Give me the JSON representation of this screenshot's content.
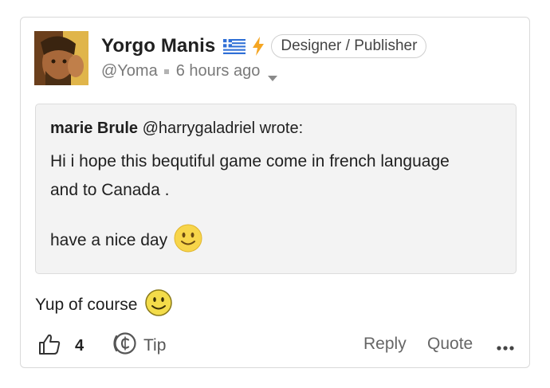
{
  "post": {
    "author": {
      "name": "Yorgo Manis",
      "handle": "@Yoma",
      "role_badge": "Designer / Publisher",
      "flag_icon": "greece-flag-icon",
      "badge_icon": "lightning-bolt-icon"
    },
    "time_ago": "6 hours ago",
    "quote": {
      "author_name": "marie Brule",
      "author_handle": "@harrygaladriel",
      "wrote": "wrote:",
      "line1": "Hi i hope this bequtiful game come in french language",
      "line2": "and to Canada .",
      "line3": "have a nice day"
    },
    "reply_text": "Yup of course",
    "actions": {
      "like_count": "4",
      "tip_label": "Tip",
      "reply_label": "Reply",
      "quote_label": "Quote"
    },
    "colors": {
      "accent_bolt": "#f5a623",
      "flag_blue": "#2f6fd6",
      "emoji_yellow": "#f7d54a"
    }
  }
}
